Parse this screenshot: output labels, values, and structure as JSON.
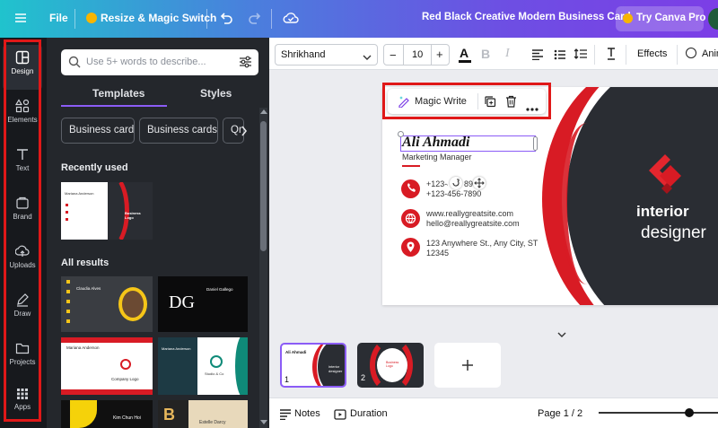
{
  "topbar": {
    "file_label": "File",
    "resize_label": "Resize & Magic Switch",
    "doc_title": "Red Black Creative Modern Business Card",
    "try_pro_label": "Try Canva Pro"
  },
  "sidebar": {
    "items": [
      {
        "label": "Design",
        "icon": "design-icon"
      },
      {
        "label": "Elements",
        "icon": "elements-icon"
      },
      {
        "label": "Text",
        "icon": "text-icon"
      },
      {
        "label": "Brand",
        "icon": "brand-icon"
      },
      {
        "label": "Uploads",
        "icon": "uploads-icon"
      },
      {
        "label": "Draw",
        "icon": "draw-icon"
      },
      {
        "label": "Projects",
        "icon": "projects-icon"
      },
      {
        "label": "Apps",
        "icon": "apps-icon"
      }
    ]
  },
  "panel": {
    "search_placeholder": "Use 5+ words to describe...",
    "tabs": [
      "Templates",
      "Styles"
    ],
    "chips": [
      "Business card",
      "Business cards",
      "Qr"
    ],
    "recently_used": "Recently used",
    "all_results": "All results",
    "thumb_texts": {
      "recent_name": "Mariana Anderson",
      "recent_brand": "Business Logo",
      "t1_name": "Claudia Alves",
      "t2_name": "Daniel Gallego",
      "t2_logo": "DG",
      "t3_name": "Mariana Anderson",
      "t3_logo": "Company Logo",
      "t4_name": "Mariana Anderson",
      "t4_logo": "Studio & Co",
      "t5_name": "Kim Chun Hoi",
      "t6_name": "Estelle Darcy"
    }
  },
  "toolbar": {
    "font_name": "Shrikhand",
    "font_size": "10",
    "effects_label": "Effects",
    "animate_label": "Animate"
  },
  "card": {
    "name": "Ali Ahmadi",
    "role": "Marketing Manager",
    "phone1": "+123-456-7890",
    "phone2": "+123-456-7890",
    "web": "www.reallygreatsite.com",
    "email": "hello@reallygreatsite.com",
    "address1": "123 Anywhere St., Any City, ST",
    "address2": "12345",
    "brand1": "interior",
    "brand2": "designer"
  },
  "magic_write": {
    "label": "Magic Write"
  },
  "pages": {
    "p1_num": "1",
    "p2_num": "2",
    "p1_name": "Ali Ahmadi",
    "p1_brand": "interior designer",
    "p2_brand": "Business Logo"
  },
  "footer": {
    "notes_label": "Notes",
    "duration_label": "Duration",
    "page_indicator": "Page 1 / 2"
  },
  "colors": {
    "accent_red": "#d81b24",
    "dark_card": "#2a2d33",
    "annotation_red": "#e01818"
  }
}
